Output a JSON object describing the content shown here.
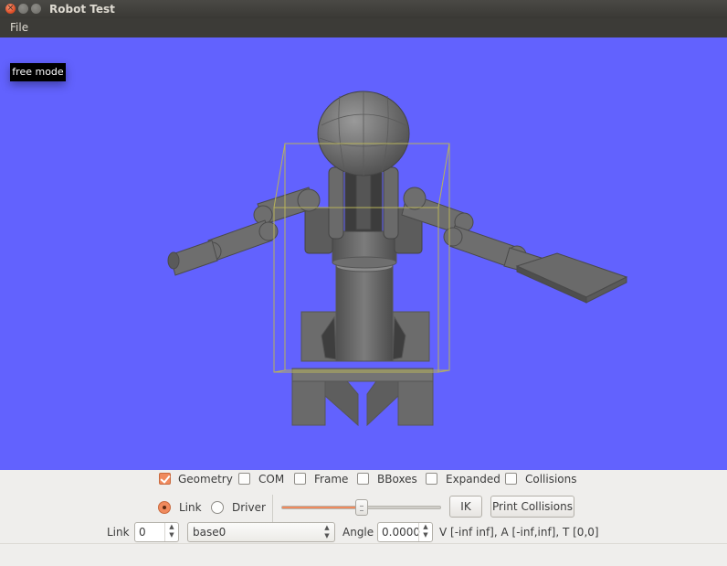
{
  "window": {
    "title": "Robot Test"
  },
  "menu": {
    "file": "File"
  },
  "viewport": {
    "mode_label": "free mode",
    "background_color": "#6262fe"
  },
  "display_options": {
    "geometry": {
      "label": "Geometry",
      "checked": true
    },
    "com": {
      "label": "COM",
      "checked": false
    },
    "frame": {
      "label": "Frame",
      "checked": false
    },
    "bboxes": {
      "label": "BBoxes",
      "checked": false
    },
    "expanded": {
      "label": "Expanded",
      "checked": false
    },
    "collisions": {
      "label": "Collisions",
      "checked": false
    }
  },
  "control_mode": {
    "link": {
      "label": "Link",
      "selected": true
    },
    "driver": {
      "label": "Driver",
      "selected": false
    }
  },
  "slider": {
    "value_fraction": 0.5
  },
  "buttons": {
    "ik": "IK",
    "print_collisions": "Print Collisions"
  },
  "link_row": {
    "label": "Link",
    "index": "0",
    "name": "base0",
    "angle_label": "Angle",
    "angle": "0.0000",
    "info": "V [-inf inf], A [-inf,inf], T [0,0]"
  },
  "colors": {
    "accent": "#f08a5d",
    "robot": "#6e6e6e",
    "bbox": "#b8b35a"
  }
}
